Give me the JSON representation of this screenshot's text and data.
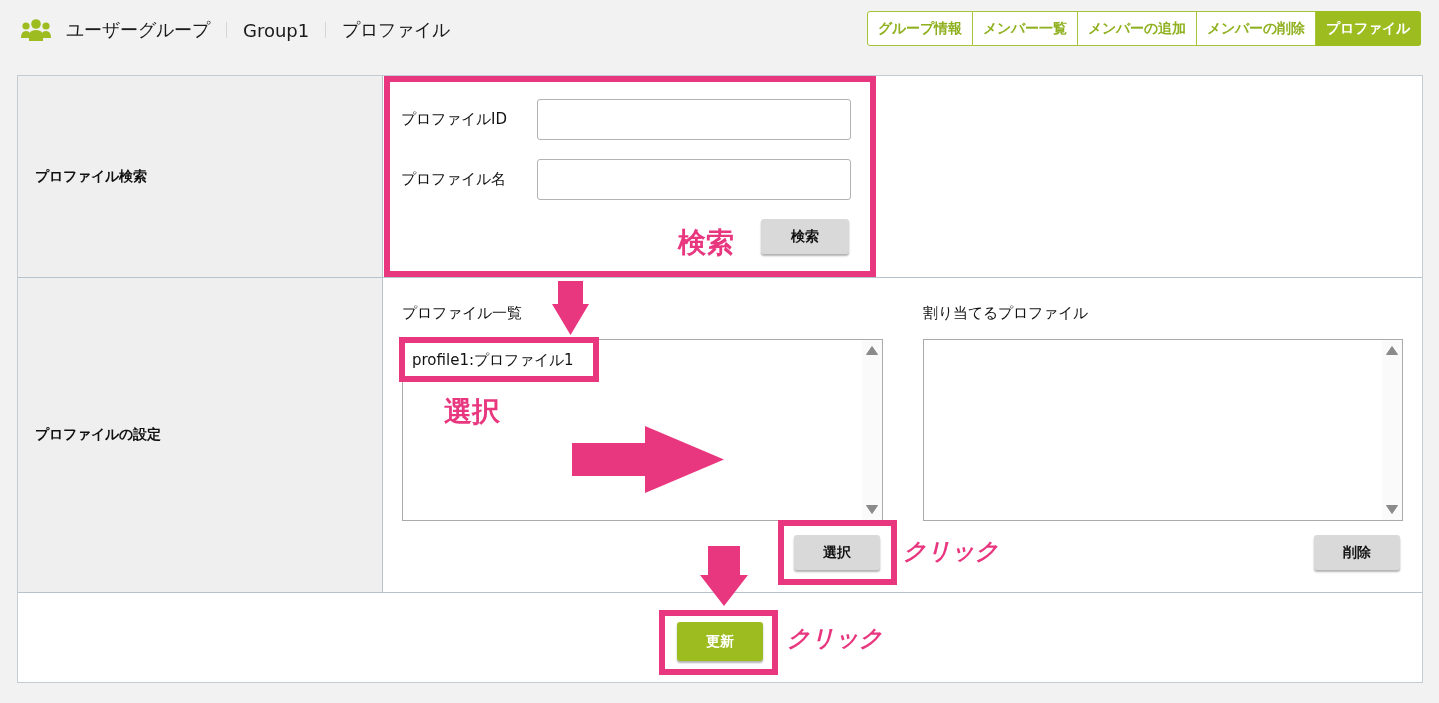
{
  "header": {
    "title": "ユーザーグループ",
    "breadcrumbs": [
      "Group1",
      "プロファイル"
    ]
  },
  "tabs": [
    {
      "label": "グループ情報",
      "selected": false
    },
    {
      "label": "メンバー一覧",
      "selected": false
    },
    {
      "label": "メンバーの追加",
      "selected": false
    },
    {
      "label": "メンバーの削除",
      "selected": false
    },
    {
      "label": "プロファイル",
      "selected": true
    }
  ],
  "search": {
    "label": "プロファイル検索",
    "fields": [
      {
        "label": "プロファイルID"
      },
      {
        "label": "プロファイル名"
      }
    ],
    "button": "検索"
  },
  "settings": {
    "label": "プロファイルの設定",
    "lists": [
      {
        "label": "プロファイル一覧",
        "items": [
          {
            "text": "profile1:プロファイル1",
            "selected": false
          }
        ],
        "button": "選択"
      },
      {
        "label": "割り当てるプロファイル",
        "button": "削除"
      }
    ]
  },
  "update_button": "更新",
  "annotations": {
    "search_note": "検索",
    "select_note": "選択",
    "click_notes": [
      "クリック",
      "クリック"
    ]
  }
}
